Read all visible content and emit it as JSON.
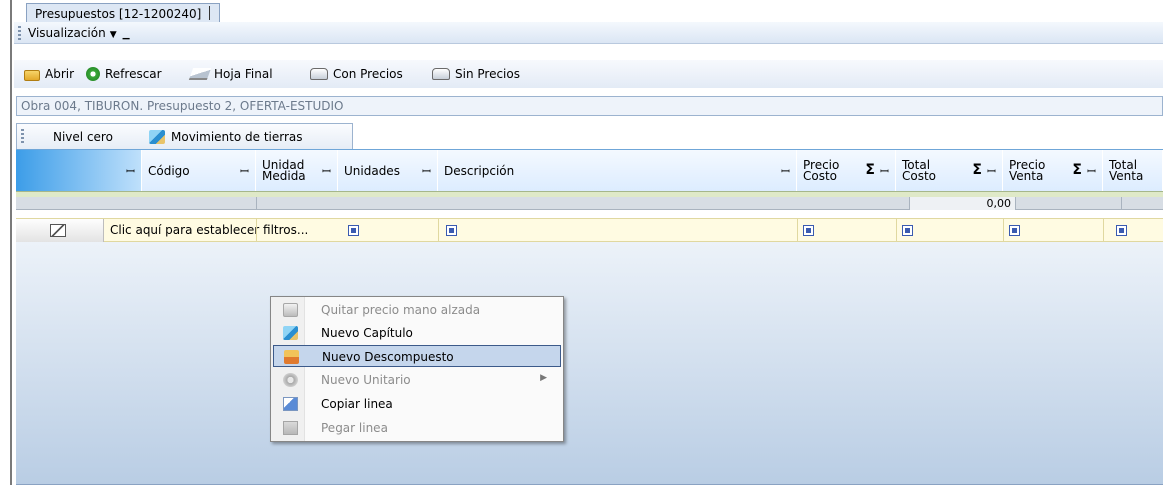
{
  "tab": {
    "title": "Presupuestos [12-1200240]"
  },
  "menubar": {
    "visualizacion_label": "Visualización"
  },
  "toolbar": {
    "abrir": "Abrir",
    "refrescar": "Refrescar",
    "hoja_final": "Hoja Final",
    "con_precios": "Con Precios",
    "sin_precios": "Sin Precios"
  },
  "info": {
    "text": "Obra 004, TIBURON. Presupuesto 2, OFERTA-ESTUDIO"
  },
  "levels": {
    "nivel_cero": "Nivel cero",
    "current": "Movimiento de tierras"
  },
  "columns": {
    "codigo": "Código",
    "unidad_medida_1": "Unidad",
    "unidad_medida_2": "Medida",
    "unidades": "Unidades",
    "descripcion": "Descripción",
    "precio_costo_1": "Precio",
    "precio_costo_2": "Costo",
    "total_costo_1": "Total",
    "total_costo_2": "Costo",
    "precio_venta_1": "Precio",
    "precio_venta_2": "Venta",
    "total_venta_1": "Total",
    "total_venta_2": "Venta"
  },
  "totals": {
    "total_costo": "0,00"
  },
  "filter": {
    "text": "Clic aquí para establecer filtros..."
  },
  "context_menu": {
    "items": [
      {
        "label": "Quitar precio mano alzada",
        "icon": "remove-price-icon",
        "enabled": false
      },
      {
        "label": "Nuevo Capítulo",
        "icon": "chapter-cube-icon",
        "enabled": true
      },
      {
        "label": "Nuevo Descompuesto",
        "icon": "decomposed-icon",
        "enabled": true,
        "highlighted": true
      },
      {
        "label": "Nuevo Unitario",
        "icon": "unit-gear-icon",
        "enabled": false,
        "submenu": true
      },
      {
        "label": "Copiar linea",
        "icon": "copy-icon",
        "enabled": true
      },
      {
        "label": "Pegar linea",
        "icon": "paste-icon",
        "enabled": false
      }
    ]
  }
}
